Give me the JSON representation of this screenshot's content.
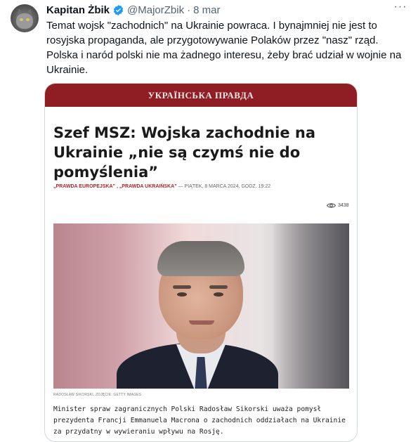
{
  "tweet": {
    "author_name": "Kapitan Żbik",
    "handle": "@MajorZbik",
    "separator": "·",
    "date": "8 mar",
    "more_label": "···",
    "text": "Temat wojsk \"zachodnich\" na Ukrainie powraca. I bynajmniej nie jest to rosyjska propaganda, ale przygotowywanie Polaków przez \"nasz\" rząd. Polska i naród polski nie ma żadnego interesu, żeby brać udział w wojnie na Ukrainie."
  },
  "article": {
    "masthead": "УКРАЇНСЬКА ПРАВДА",
    "headline": "Szef MSZ: Wojska zachodnie na Ukrainie „nie są czymś nie do pomyślenia”",
    "byline_tags": "„PRAWDA EUROPEJSKA” , „PRAWDA UKRAIŃSKA”",
    "byline_date": " — PIĄTEK, 8 MARCA 2024, GODZ. 19:22",
    "views": "3438",
    "photo_credit": "RADOSŁAW SIKORSKI. ZDJĘCIE: GETTY IMAGES",
    "caption": "Minister spraw zagranicznych Polski Radosław Sikorski uważa pomysł prezydenta Francji Emmanuela Macrona o zachodnich oddziałach na Ukrainie za przydatny w wywieraniu wpływu na Rosję."
  },
  "colors": {
    "masthead": "#8f1d24",
    "verified": "#1d9bf0",
    "muted_text": "#536471"
  }
}
